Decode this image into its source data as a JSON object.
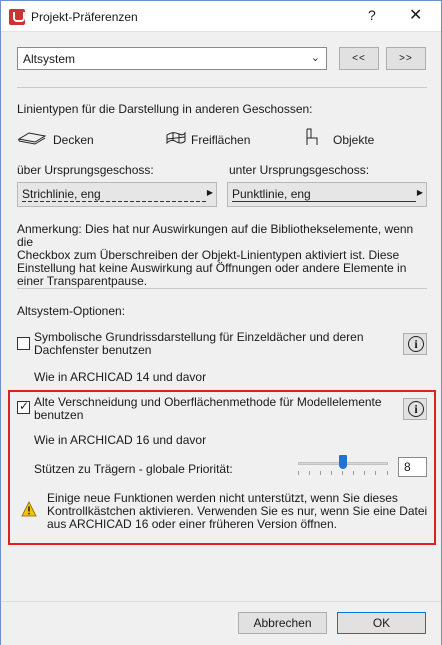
{
  "window": {
    "title": "Projekt-Präferenzen",
    "help_glyph": "?",
    "close_glyph": "✕"
  },
  "top": {
    "preset_value": "Altsystem",
    "prev_label": "<<",
    "next_label": ">>"
  },
  "linetypes": {
    "heading": "Linientypen für die Darstellung in anderen Geschossen:",
    "items": [
      {
        "label": "Decken",
        "icon": "slab-icon"
      },
      {
        "label": "Freiflächen",
        "icon": "mesh-icon"
      },
      {
        "label": "Objekte",
        "icon": "chair-icon"
      }
    ],
    "above_label": "über Ursprungsgeschoss:",
    "below_label": "unter Ursprungsgeschoss:",
    "above_value": "Strichlinie, eng",
    "below_value": "Punktlinie, eng",
    "note_lines": [
      "Anmerkung: Dies hat nur Auswirkungen auf die Bibliothekselemente, wenn die",
      "Checkbox zum Überschreiben der Objekt-Linientypen aktiviert ist. Diese",
      "Einstellung hat keine Auswirkung auf Öffnungen oder andere Elemente in",
      "einer Transparentpause."
    ]
  },
  "legacy": {
    "heading": "Altsystem-Optionen:",
    "option1": {
      "checked": false,
      "label_lines": [
        "Symbolische Grundrissdarstellung für Einzeldächer und deren",
        "Dachfenster benutzen"
      ],
      "note": "Wie in ARCHICAD 14 und davor"
    },
    "option2": {
      "checked": true,
      "label_lines": [
        "Alte Verschneidung und Oberflächenmethode für Modellelemente",
        "benutzen"
      ],
      "note": "Wie in ARCHICAD 16 und davor",
      "priority_label": "Stützen zu Trägern - globale Priorität:",
      "priority_value": "8",
      "slider_fraction": 0.5,
      "warning_lines": [
        "Einige neue Funktionen werden nicht unterstützt, wenn Sie dieses",
        "Kontrollkästchen aktivieren. Verwenden Sie es nur, wenn Sie eine Datei",
        "aus ARCHICAD 16 oder einer früheren Version öffnen."
      ]
    },
    "info_glyph": "i",
    "highlight_color": "#e02020"
  },
  "footer": {
    "cancel_label": "Abbrechen",
    "ok_label": "OK"
  }
}
